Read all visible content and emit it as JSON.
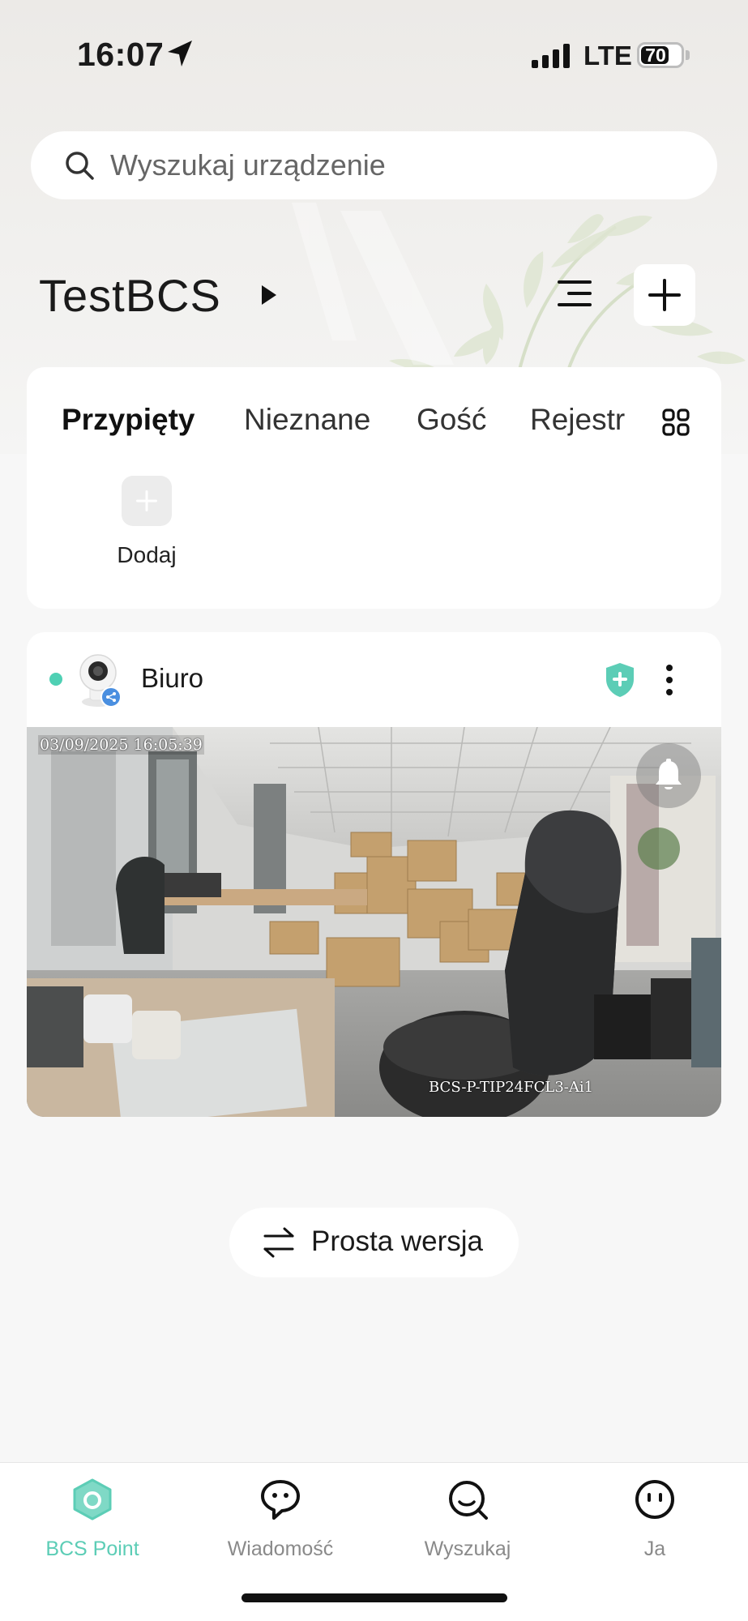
{
  "status_bar": {
    "time": "16:07",
    "network": "LTE",
    "battery": "70",
    "battery_level": 0.7
  },
  "search": {
    "placeholder": "Wyszukaj urządzenie"
  },
  "header": {
    "home_name": "TestBCS"
  },
  "scenes": {
    "tabs": [
      {
        "label": "Przypięty",
        "active": true
      },
      {
        "label": "Nieznane",
        "active": false
      },
      {
        "label": "Gość",
        "active": false
      },
      {
        "label": "Rejestr",
        "active": false
      }
    ],
    "add_label": "Dodaj"
  },
  "device": {
    "name": "Biuro",
    "status": "online",
    "status_color": "#4fd0b4",
    "shield_color": "#5ccdb6",
    "osd_timestamp": "03/09/2025 16:05:39",
    "osd_model": "BCS-P-TIP24FCL3-Ai1"
  },
  "simple_version": {
    "label": "Prosta wersja"
  },
  "bottom_nav": {
    "items": [
      {
        "label": "BCS Point",
        "icon": "home-hexagon-icon",
        "active": true
      },
      {
        "label": "Wiadomość",
        "icon": "message-icon",
        "active": false
      },
      {
        "label": "Wyszukaj",
        "icon": "search-icon",
        "active": false
      },
      {
        "label": "Ja",
        "icon": "profile-icon",
        "active": false
      }
    ],
    "accent_color": "#5ccdb6"
  }
}
